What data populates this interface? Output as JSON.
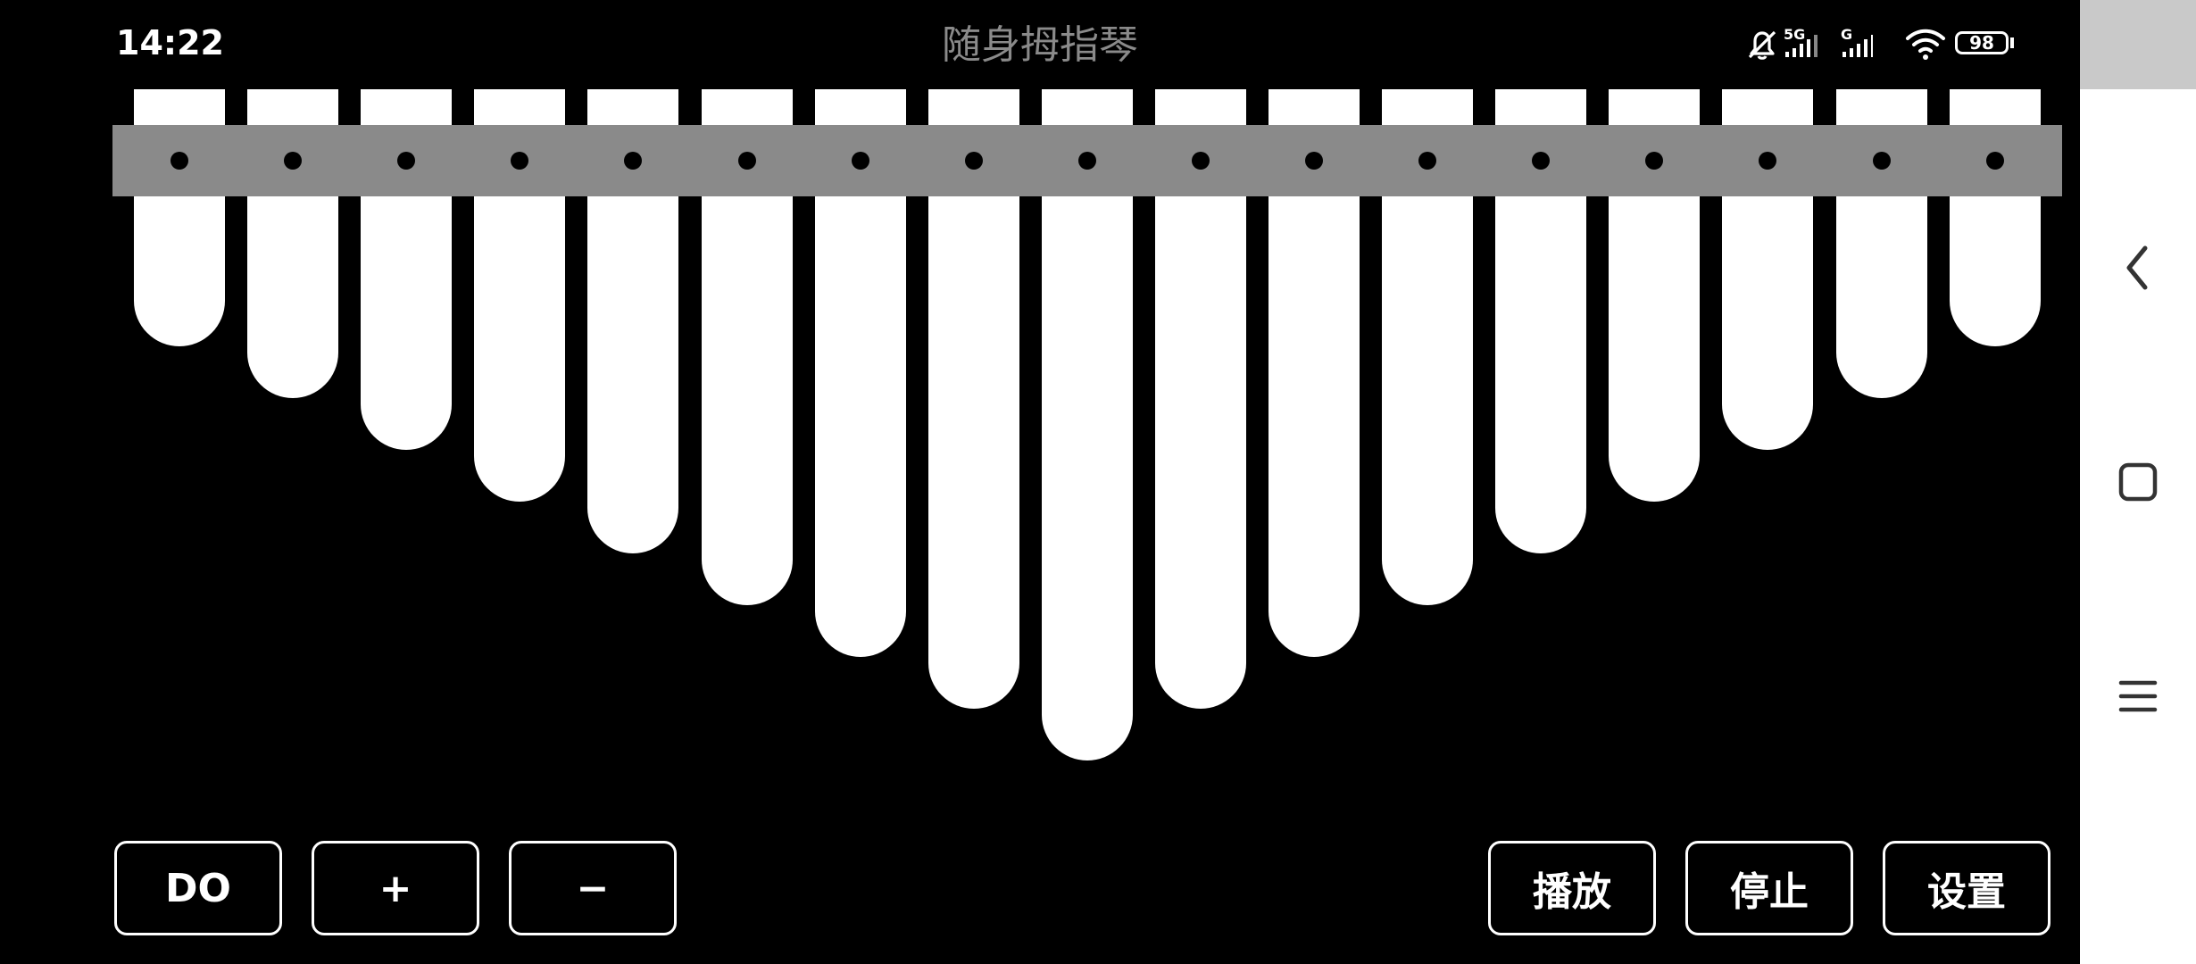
{
  "status_bar": {
    "time": "14:22",
    "network_5g": "5G",
    "network_g": "G",
    "battery": "98"
  },
  "app": {
    "title": "随身拇指琴"
  },
  "kalimba": {
    "tine_count": 17
  },
  "controls": {
    "key_label": "DO",
    "plus_label": "+",
    "minus_label": "−",
    "play_label": "播放",
    "stop_label": "停止",
    "settings_label": "设置"
  },
  "nav": {
    "back_icon": "back-chevron-icon",
    "home_icon": "square-home-icon",
    "menu_icon": "menu-lines-icon"
  },
  "colors": {
    "background": "#000000",
    "tine": "#ffffff",
    "bridge": "#8a8a8a",
    "title": "#8a8a8a"
  }
}
